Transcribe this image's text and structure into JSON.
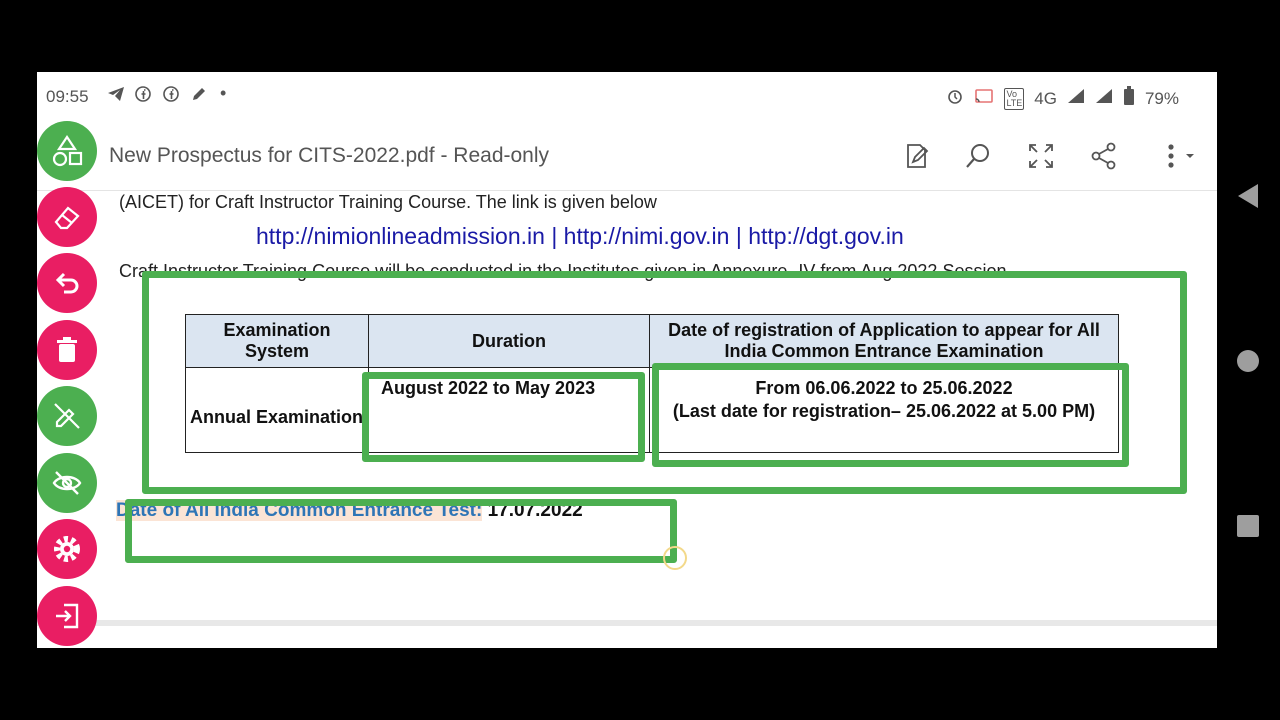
{
  "status_bar": {
    "time": "09:55",
    "network": "4G",
    "battery": "79%"
  },
  "app_bar": {
    "title": "New Prospectus for CITS-2022.pdf - Read-only"
  },
  "document": {
    "line1": "(AICET) for Craft Instructor Training Course. The link is given below",
    "links": "http://nimionlineadmission.in | http://nimi.gov.in | http://dgt.gov.in",
    "line3": "Craft Instructor Training Course will be conducted in the Institutes given in Annexure- IV from Aug 2022 Session",
    "table": {
      "headers": [
        "Examination System",
        "Duration",
        "Date of registration of Application to appear for All India Common Entrance Examination"
      ],
      "row": {
        "system": "Annual Examination",
        "duration": "August 2022 to May 2023",
        "registration_line1": "From 06.06.2022  to 25.06.2022",
        "registration_line2": "(Last date for registration– 25.06.2022 at 5.00 PM)"
      }
    },
    "cet_label": "Date of All India Common Entrance Test:",
    "cet_date": " 17.07.2022"
  },
  "colors": {
    "highlight": "#4caf50",
    "link": "#1a1aa6",
    "fab_green": "#4caf50",
    "fab_pink": "#e91e63"
  }
}
